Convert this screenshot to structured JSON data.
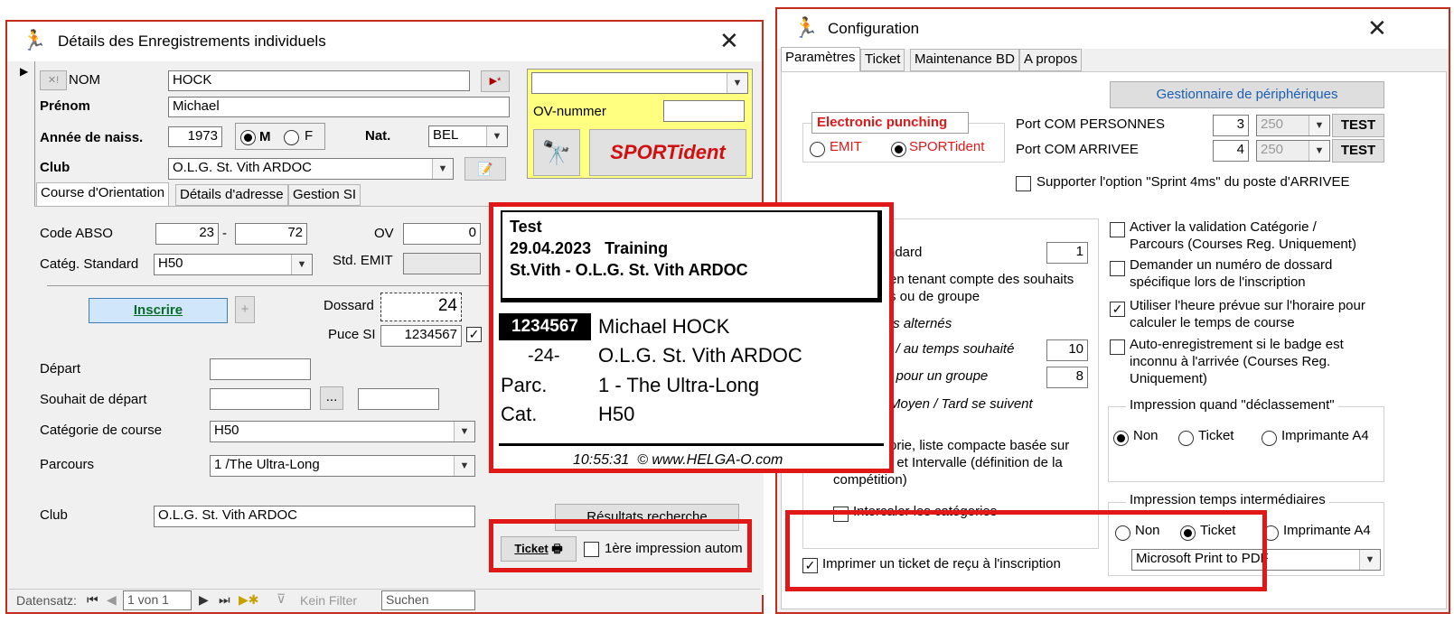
{
  "left_window": {
    "title": "Détails des Enregistrements individuels",
    "close": "✕",
    "nom_label": "NOM",
    "nom_value": "HOCK",
    "prenom_label": "Prénom",
    "prenom_value": "Michael",
    "annee_label": "Année de naiss.",
    "annee_value": "1973",
    "sex_m": "M",
    "sex_f": "F",
    "nat_label": "Nat.",
    "nat_value": "BEL",
    "club_label": "Club",
    "club_value": "O.L.G. St. Vith ARDOC",
    "ov_nummer_label": "OV-nummer",
    "sportident_button": "SPORTident",
    "tabs": [
      "Course d'Orientation",
      "Détails d'adresse",
      "Gestion SI"
    ],
    "code_abso_label": "Code ABSO",
    "code_abso_1": "23",
    "code_abso_dash": "-",
    "code_abso_2": "72",
    "ov_label": "OV",
    "ov_value": "0",
    "categ_label": "Catég. Standard",
    "categ_value": "H50",
    "std_emit_label": "Std. EMIT",
    "inscrire_label": "Inscrire",
    "plus_label": "+",
    "dossard_label": "Dossard",
    "dossard_value": "24",
    "puce_label": "Puce SI",
    "puce_value": "1234567",
    "depart_label": "Départ",
    "souhait_label": "Souhait de départ",
    "ellipsis": "...",
    "cat_course_label": "Catégorie de course",
    "cat_course_value": "H50",
    "parcours_label": "Parcours",
    "parcours_value": "1 /The Ultra-Long",
    "club2_label": "Club",
    "club2_value": "O.L.G. St. Vith ARDOC",
    "resultats_button": "Résultats recherche",
    "ticket_button": "Ticket",
    "impression_autom": "1ère impression autom",
    "nav": {
      "datensatz": "Datensatz:",
      "position": "1 von 1",
      "kein_filter": "Kein Filter",
      "suchen": "Suchen"
    }
  },
  "ticket": {
    "line1": "Test",
    "line2": "29.04.2023   Training",
    "line3": "St.Vith - O.L.G. St. Vith ARDOC",
    "chip": "1234567",
    "name": "Michael HOCK",
    "bib": "-24-",
    "club": "O.L.G. St. Vith ARDOC",
    "parc_label": "Parc.",
    "parc_value": "1 - The Ultra-Long",
    "cat_label": "Cat.",
    "cat_value": "H50",
    "footer": "10:55:31  © www.HELGA-O.com"
  },
  "right_window": {
    "title": "Configuration",
    "close": "✕",
    "tabs": [
      "Paramètres",
      "Ticket",
      "Maintenance BD",
      "A propos"
    ],
    "gestionnaire_button": "Gestionnaire de périphériques",
    "electronic_punching": "Electronic punching",
    "emit": "EMIT",
    "sportident": "SPORTident",
    "port_personnes_label": "Port COM PERSONNES",
    "port_personnes_value": "3",
    "port_personnes_speed": "250",
    "port_arrivee_label": "Port COM ARRIVEE",
    "port_arrivee_value": "4",
    "port_arrivee_speed": "250",
    "test_button": "TEST",
    "sprint_option": "Supporter l'option \"Sprint 4ms\" du poste d'ARRIVEE",
    "left_partial": {
      "ndard": "ndard",
      "ndard_value": "1",
      "souhaits1": "en tenant compte des souhaits",
      "souhaits2": "s ou de groupe",
      "alternes": "ts alternés",
      "temps_souhaite": "i / au temps souhaité",
      "temps_souhaite_value": "10",
      "groupe": "i pour un groupe",
      "groupe_value": "8",
      "moyen_tard": "Moyen / Tard se suivent",
      "compacte1": "orie, liste compacte basée sur",
      "compacte2": "t et Intervalle (définition de la",
      "competition": "compétition)",
      "intercaler": "Intercaler les catégories"
    },
    "activer1": "Activer la validation Catégorie /",
    "activer2": "Parcours  (Courses Reg. Uniquement)",
    "demander1": "Demander un numéro de dossard",
    "demander2": "spécifique lors de l'inscription",
    "utiliser1": "Utiliser l'heure prévue sur l'horaire pour",
    "utiliser2": "calculer le temps de course",
    "auto1": "Auto-enregistrement si le badge est",
    "auto2": "inconnu à l'arrivée (Courses Reg.",
    "auto3": "Uniquement)",
    "impression_declassement": "Impression quand \"déclassement\"",
    "non": "Non",
    "ticket": "Ticket",
    "imprimante_a4": "Imprimante A4",
    "impression_temps": "Impression temps intermédiaires",
    "printer_value": "Microsoft Print to PDF",
    "imprimer_ticket": "Imprimer un ticket de reçu à l'inscription"
  }
}
